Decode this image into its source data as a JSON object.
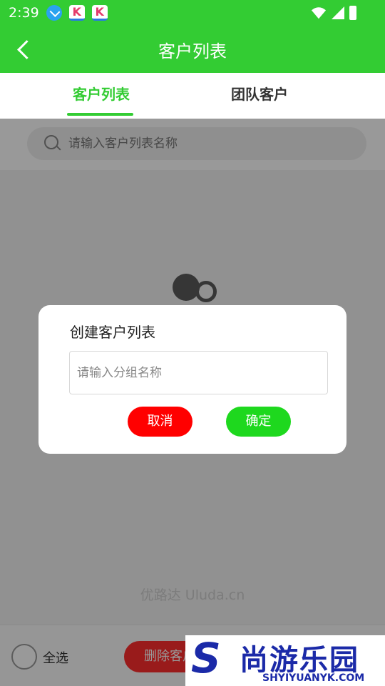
{
  "status_bar": {
    "time": "2:39",
    "app_icon_letter": "K"
  },
  "app_bar": {
    "title": "客户列表"
  },
  "tabs": [
    {
      "label": "客户列表",
      "active": true
    },
    {
      "label": "团队客户",
      "active": false
    }
  ],
  "search": {
    "placeholder": "请输入客户列表名称"
  },
  "watermark": "优路达 Uluda.cn",
  "bottom_bar": {
    "select_all_label": "全选",
    "delete_button_label": "删除客户"
  },
  "dialog": {
    "title": "创建客户列表",
    "input_placeholder": "请输入分组名称",
    "input_value": "",
    "cancel_label": "取消",
    "confirm_label": "确定"
  },
  "logo": {
    "mark": "S",
    "name": "尚游乐园",
    "domain": "SHYIYUANYK.COM"
  },
  "colors": {
    "primary_green": "#33cc33",
    "cancel_red": "#ff0000",
    "confirm_green": "#1ed81e",
    "delete_red": "#ff2d2d",
    "logo_blue": "#1b2aa8"
  }
}
